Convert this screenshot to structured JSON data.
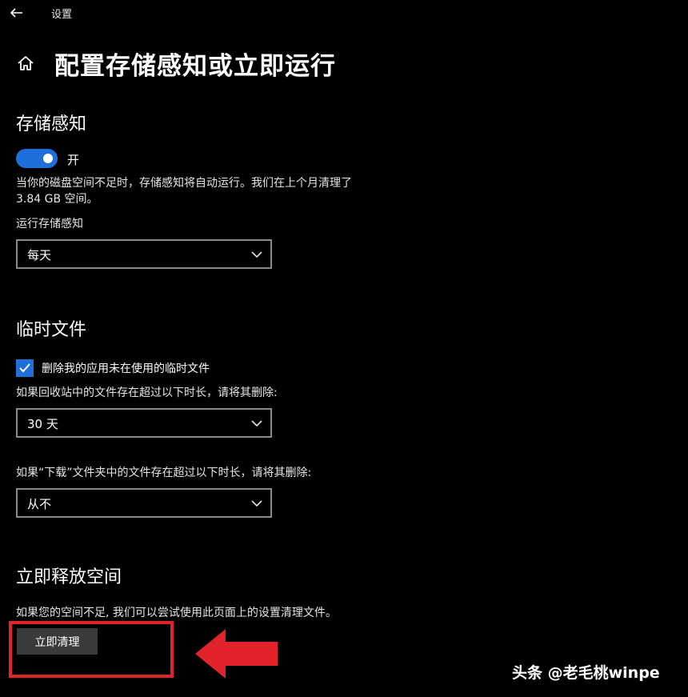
{
  "window": {
    "app_title": "设置"
  },
  "header": {
    "page_title": "配置存储感知或立即运行"
  },
  "storage_sense": {
    "section_title": "存储感知",
    "toggle_state": "开",
    "toggle_on": true,
    "description_line1": "当你的磁盘空间不足时，存储感知将自动运行。我们在上个月清理了",
    "description_line2": "3.84 GB 空间。",
    "run_label": "运行存储感知",
    "run_value": "每天"
  },
  "temp_files": {
    "section_title": "临时文件",
    "checkbox_label": "删除我的应用未在使用的临时文件",
    "checkbox_checked": true,
    "recycle_label": "如果回收站中的文件存在超过以下时长，请将其删除:",
    "recycle_value": "30 天",
    "downloads_label": "如果“下载”文件夹中的文件存在超过以下时长，请将其删除:",
    "downloads_value": "从不"
  },
  "free_space": {
    "section_title": "立即释放空间",
    "description": "如果您的空间不足, 我们可以尝试使用此页面上的设置清理文件。",
    "button_label": "立即清理"
  },
  "colors": {
    "accent": "#1e6fd9",
    "highlight": "#e3232b",
    "background": "#000000"
  },
  "watermark": "头条 @老毛桃winpe"
}
